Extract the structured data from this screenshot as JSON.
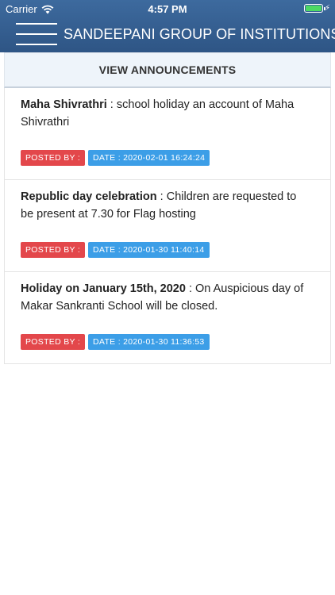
{
  "status_bar": {
    "carrier": "Carrier",
    "time": "4:57 PM",
    "battery_icon": "battery-full-icon",
    "wifi_icon": "wifi-icon"
  },
  "header": {
    "menu_icon": "hamburger-menu-icon",
    "title": "SANDEEPANI GROUP OF INSTITUTIONS",
    "color": "#34608f"
  },
  "section": {
    "title": "VIEW ANNOUNCEMENTS"
  },
  "announcements": [
    {
      "title": "Maha Shivrathri",
      "separator": " : ",
      "body": "school holiday an account of Maha Shivrathri",
      "posted_by_label": "POSTED BY :",
      "date_label": "DATE : 2020-02-01 16:24:24"
    },
    {
      "title": "Republic day celebration",
      "separator": " : ",
      "body": "Children are requested to be present at 7.30 for Flag hosting",
      "posted_by_label": "POSTED BY :",
      "date_label": "DATE : 2020-01-30 11:40:14"
    },
    {
      "title": "Holiday on January 15th, 2020",
      "separator": " : ",
      "body": "On Auspicious day of Makar Sankranti School will be closed.",
      "posted_by_label": "POSTED BY :",
      "date_label": "DATE : 2020-01-30 11:36:53"
    }
  ],
  "colors": {
    "posted_by_badge": "#e3474b",
    "date_badge": "#3c9ee7",
    "battery": "#4cd964"
  }
}
